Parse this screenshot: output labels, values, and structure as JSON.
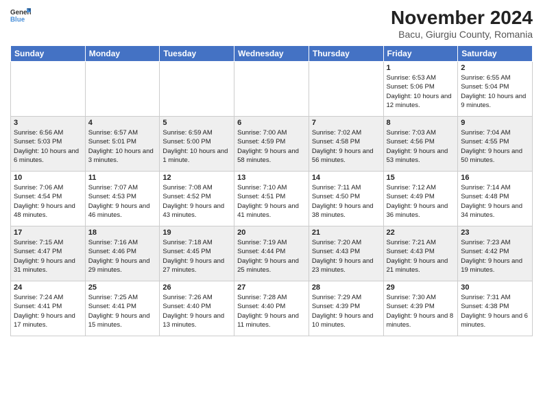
{
  "logo": {
    "general": "General",
    "blue": "Blue"
  },
  "title": "November 2024",
  "location": "Bacu, Giurgiu County, Romania",
  "days_of_week": [
    "Sunday",
    "Monday",
    "Tuesday",
    "Wednesday",
    "Thursday",
    "Friday",
    "Saturday"
  ],
  "weeks": [
    [
      {
        "day": "",
        "info": ""
      },
      {
        "day": "",
        "info": ""
      },
      {
        "day": "",
        "info": ""
      },
      {
        "day": "",
        "info": ""
      },
      {
        "day": "",
        "info": ""
      },
      {
        "day": "1",
        "info": "Sunrise: 6:53 AM\nSunset: 5:06 PM\nDaylight: 10 hours and 12 minutes."
      },
      {
        "day": "2",
        "info": "Sunrise: 6:55 AM\nSunset: 5:04 PM\nDaylight: 10 hours and 9 minutes."
      }
    ],
    [
      {
        "day": "3",
        "info": "Sunrise: 6:56 AM\nSunset: 5:03 PM\nDaylight: 10 hours and 6 minutes."
      },
      {
        "day": "4",
        "info": "Sunrise: 6:57 AM\nSunset: 5:01 PM\nDaylight: 10 hours and 3 minutes."
      },
      {
        "day": "5",
        "info": "Sunrise: 6:59 AM\nSunset: 5:00 PM\nDaylight: 10 hours and 1 minute."
      },
      {
        "day": "6",
        "info": "Sunrise: 7:00 AM\nSunset: 4:59 PM\nDaylight: 9 hours and 58 minutes."
      },
      {
        "day": "7",
        "info": "Sunrise: 7:02 AM\nSunset: 4:58 PM\nDaylight: 9 hours and 56 minutes."
      },
      {
        "day": "8",
        "info": "Sunrise: 7:03 AM\nSunset: 4:56 PM\nDaylight: 9 hours and 53 minutes."
      },
      {
        "day": "9",
        "info": "Sunrise: 7:04 AM\nSunset: 4:55 PM\nDaylight: 9 hours and 50 minutes."
      }
    ],
    [
      {
        "day": "10",
        "info": "Sunrise: 7:06 AM\nSunset: 4:54 PM\nDaylight: 9 hours and 48 minutes."
      },
      {
        "day": "11",
        "info": "Sunrise: 7:07 AM\nSunset: 4:53 PM\nDaylight: 9 hours and 46 minutes."
      },
      {
        "day": "12",
        "info": "Sunrise: 7:08 AM\nSunset: 4:52 PM\nDaylight: 9 hours and 43 minutes."
      },
      {
        "day": "13",
        "info": "Sunrise: 7:10 AM\nSunset: 4:51 PM\nDaylight: 9 hours and 41 minutes."
      },
      {
        "day": "14",
        "info": "Sunrise: 7:11 AM\nSunset: 4:50 PM\nDaylight: 9 hours and 38 minutes."
      },
      {
        "day": "15",
        "info": "Sunrise: 7:12 AM\nSunset: 4:49 PM\nDaylight: 9 hours and 36 minutes."
      },
      {
        "day": "16",
        "info": "Sunrise: 7:14 AM\nSunset: 4:48 PM\nDaylight: 9 hours and 34 minutes."
      }
    ],
    [
      {
        "day": "17",
        "info": "Sunrise: 7:15 AM\nSunset: 4:47 PM\nDaylight: 9 hours and 31 minutes."
      },
      {
        "day": "18",
        "info": "Sunrise: 7:16 AM\nSunset: 4:46 PM\nDaylight: 9 hours and 29 minutes."
      },
      {
        "day": "19",
        "info": "Sunrise: 7:18 AM\nSunset: 4:45 PM\nDaylight: 9 hours and 27 minutes."
      },
      {
        "day": "20",
        "info": "Sunrise: 7:19 AM\nSunset: 4:44 PM\nDaylight: 9 hours and 25 minutes."
      },
      {
        "day": "21",
        "info": "Sunrise: 7:20 AM\nSunset: 4:43 PM\nDaylight: 9 hours and 23 minutes."
      },
      {
        "day": "22",
        "info": "Sunrise: 7:21 AM\nSunset: 4:43 PM\nDaylight: 9 hours and 21 minutes."
      },
      {
        "day": "23",
        "info": "Sunrise: 7:23 AM\nSunset: 4:42 PM\nDaylight: 9 hours and 19 minutes."
      }
    ],
    [
      {
        "day": "24",
        "info": "Sunrise: 7:24 AM\nSunset: 4:41 PM\nDaylight: 9 hours and 17 minutes."
      },
      {
        "day": "25",
        "info": "Sunrise: 7:25 AM\nSunset: 4:41 PM\nDaylight: 9 hours and 15 minutes."
      },
      {
        "day": "26",
        "info": "Sunrise: 7:26 AM\nSunset: 4:40 PM\nDaylight: 9 hours and 13 minutes."
      },
      {
        "day": "27",
        "info": "Sunrise: 7:28 AM\nSunset: 4:40 PM\nDaylight: 9 hours and 11 minutes."
      },
      {
        "day": "28",
        "info": "Sunrise: 7:29 AM\nSunset: 4:39 PM\nDaylight: 9 hours and 10 minutes."
      },
      {
        "day": "29",
        "info": "Sunrise: 7:30 AM\nSunset: 4:39 PM\nDaylight: 9 hours and 8 minutes."
      },
      {
        "day": "30",
        "info": "Sunrise: 7:31 AM\nSunset: 4:38 PM\nDaylight: 9 hours and 6 minutes."
      }
    ]
  ]
}
